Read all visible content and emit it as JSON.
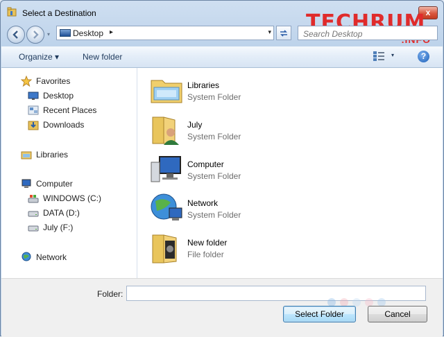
{
  "window": {
    "title": "Select a Destination",
    "close_glyph": "x"
  },
  "watermark": {
    "main": "TECHRUM",
    "sub": ".INFO"
  },
  "address": {
    "location": "Desktop",
    "separator": "▸",
    "dropdown_glyph": "▾"
  },
  "search": {
    "placeholder": "Search Desktop"
  },
  "toolbar": {
    "organize_label": "Organize ▾",
    "new_folder_label": "New folder",
    "views_drop": "▾",
    "help_label": "?"
  },
  "sidebar": {
    "items": [
      {
        "label": "Favorites",
        "icon": "star-icon"
      },
      {
        "label": "Desktop",
        "icon": "desktop-icon"
      },
      {
        "label": "Recent Places",
        "icon": "recent-places-icon"
      },
      {
        "label": "Downloads",
        "icon": "downloads-icon"
      },
      {
        "label": "Libraries",
        "icon": "libraries-icon"
      },
      {
        "label": "Computer",
        "icon": "computer-icon"
      },
      {
        "label": "WINDOWS (C:)",
        "icon": "windows-drive-icon"
      },
      {
        "label": "DATA (D:)",
        "icon": "drive-icon"
      },
      {
        "label": "July (F:)",
        "icon": "drive-icon"
      },
      {
        "label": "Network",
        "icon": "network-icon"
      }
    ]
  },
  "content": {
    "items": [
      {
        "name": "Libraries",
        "type": "System Folder",
        "icon": "libraries-folder-icon"
      },
      {
        "name": "July",
        "type": "System Folder",
        "icon": "user-folder-icon"
      },
      {
        "name": "Computer",
        "type": "System Folder",
        "icon": "computer-icon"
      },
      {
        "name": "Network",
        "type": "System Folder",
        "icon": "network-globe-icon"
      },
      {
        "name": "New folder",
        "type": "File folder",
        "icon": "folder-icon"
      }
    ]
  },
  "footer": {
    "folder_label": "Folder:",
    "folder_value": "",
    "select_label": "Select Folder",
    "cancel_label": "Cancel"
  },
  "colors": {
    "accent": "#3c7fb1",
    "close": "#c33c21",
    "watermark": "#e02b2b"
  }
}
